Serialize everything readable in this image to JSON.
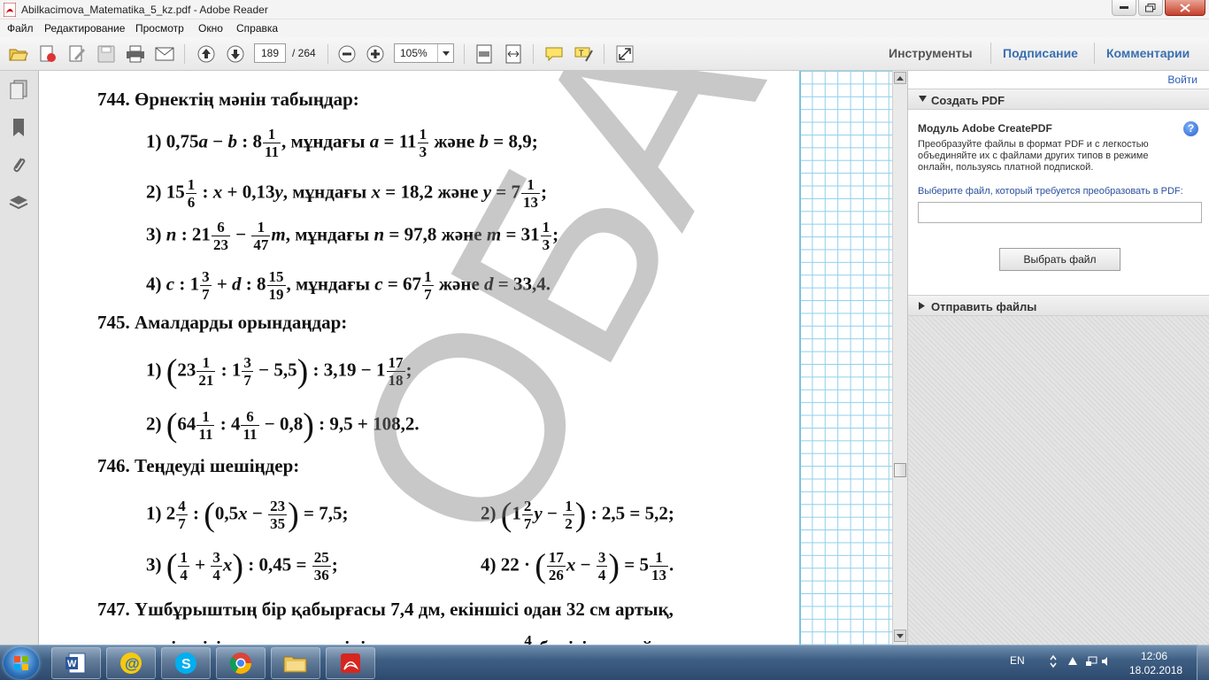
{
  "window": {
    "title": "Abilkacimova_Matematika_5_kz.pdf - Adobe Reader"
  },
  "menu": [
    "Файл",
    "Редактирование",
    "Просмотр",
    "Окно",
    "Справка"
  ],
  "toolbar": {
    "page_current": "189",
    "page_total": "/ 264",
    "zoom": "105%"
  },
  "right_tabs": [
    "Инструменты",
    "Подписание",
    "Комментарии"
  ],
  "right_panel": {
    "sign_in": "Войти",
    "create_pdf": "Создать PDF",
    "module_title": "Модуль Adobe CreatePDF",
    "module_desc": "Преобразуйте файлы в формат PDF и с легкостью объединяйте их с файлами других типов в режиме онлайн, пользуясь платной подпиской.",
    "choose_label": "Выберите файл, который требуется преобразовать в PDF:",
    "choose_button": "Выбрать файл",
    "send_files": "Отправить файлы"
  },
  "document": {
    "p744": "744. Өрнектің мәнін табыңдар:",
    "p745": "745. Амалдарды орындаңдар:",
    "p746": "746. Теңдеуді шешіңдер:",
    "p747": "747. Үшбұрыштың бір қабырғасы 7,4 дм, екіншісі одан 32 см артық,",
    "p747b": "үшіншісі алғашқы екеуінің қосындысының",
    "p747c": "бөлігін құрайды.",
    "p747_frac_num": "4",
    "watermark": "ОБА"
  },
  "taskbar": {
    "lang": "EN",
    "time": "12:06",
    "date": "18.02.2018"
  },
  "icons": {
    "app": "adobe-reader-icon",
    "taskbar_apps": [
      "word-icon",
      "mail-icon",
      "skype-icon",
      "chrome-icon",
      "explorer-icon",
      "acrobat-icon"
    ]
  }
}
